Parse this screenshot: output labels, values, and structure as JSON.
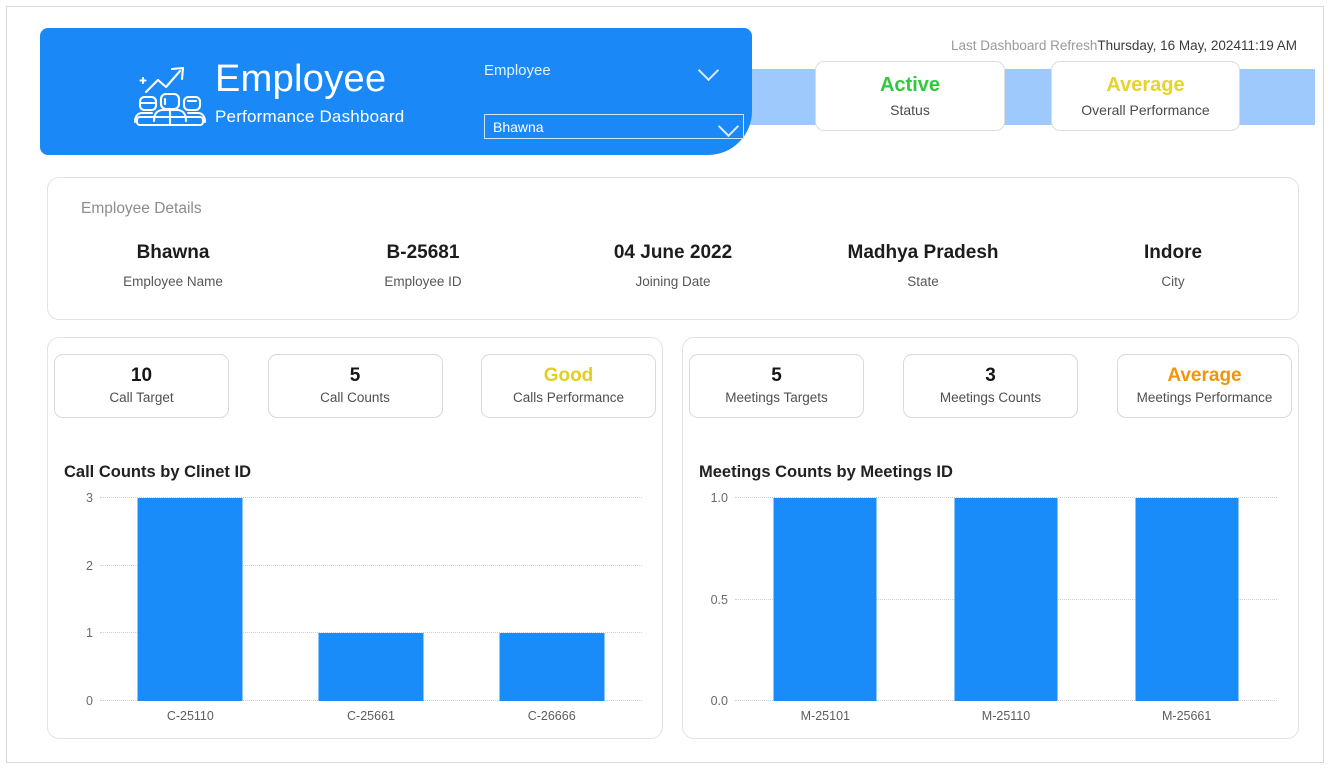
{
  "header": {
    "brand_icon": "team-growth-icon",
    "title": "Employee",
    "subtitle": "Performance Dashboard",
    "slicer": {
      "label": "Employee",
      "selected": "Bhawna",
      "chevron_icon": "chevron-down-icon"
    }
  },
  "refresh": {
    "label": "Last Dashboard Refresh",
    "value": "Thursday, 16 May, 202411:19 AM"
  },
  "top_kpis": [
    {
      "value": "Active",
      "caption": "Status",
      "color": "#2eca3d"
    },
    {
      "value": "Average",
      "caption": "Overall Performance",
      "color": "#e8d32a"
    }
  ],
  "details": {
    "title": "Employee Details",
    "fields": [
      {
        "value": "Bhawna",
        "caption": "Employee Name"
      },
      {
        "value": "B-25681",
        "caption": "Employee ID"
      },
      {
        "value": "04 June 2022",
        "caption": "Joining Date"
      },
      {
        "value": "Madhya Pradesh",
        "caption": "State"
      },
      {
        "value": "Indore",
        "caption": "City"
      }
    ]
  },
  "calls_panel": {
    "kpis": [
      {
        "value": "10",
        "caption": "Call Target",
        "color": "#161616"
      },
      {
        "value": "5",
        "caption": "Call Counts",
        "color": "#161616"
      },
      {
        "value": "Good",
        "caption": "Calls Performance",
        "color": "#e3cf1d"
      }
    ]
  },
  "meetings_panel": {
    "kpis": [
      {
        "value": "5",
        "caption": "Meetings Targets",
        "color": "#161616"
      },
      {
        "value": "3",
        "caption": "Meetings Counts",
        "color": "#161616"
      },
      {
        "value": "Average",
        "caption": "Meetings Performance",
        "color": "#f2950b"
      }
    ]
  },
  "theme": {
    "banner_blue": "#1a88f7",
    "band_blue": "#9dc9fc",
    "bar_blue": "#1a8cfa"
  },
  "chart_data": [
    {
      "type": "bar",
      "title": "Call Counts by Clinet ID",
      "categories": [
        "C-25110",
        "C-25661",
        "C-26666"
      ],
      "values": [
        3,
        1,
        1
      ],
      "ticks": [
        "0",
        "1",
        "2",
        "3"
      ],
      "tick_values": [
        0,
        1,
        2,
        3
      ],
      "ylim": [
        0,
        3
      ],
      "xlabel": "",
      "ylabel": "",
      "grid": true,
      "legend": "none",
      "series_color": "#1a8cfa"
    },
    {
      "type": "bar",
      "title": "Meetings Counts by Meetings ID",
      "categories": [
        "M-25101",
        "M-25110",
        "M-25661"
      ],
      "values": [
        1.0,
        1.0,
        1.0
      ],
      "ticks": [
        "0.0",
        "0.5",
        "1.0"
      ],
      "tick_values": [
        0,
        0.5,
        1
      ],
      "ylim": [
        0,
        1
      ],
      "xlabel": "",
      "ylabel": "",
      "grid": true,
      "legend": "none",
      "series_color": "#1a8cfa"
    }
  ]
}
